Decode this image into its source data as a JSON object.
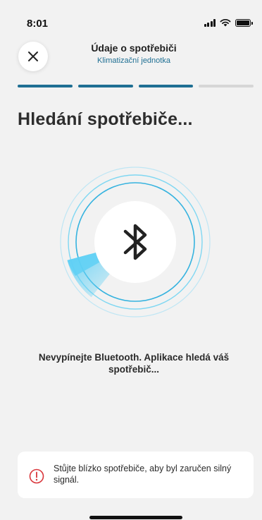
{
  "status_bar": {
    "time": "8:01"
  },
  "header": {
    "title": "Údaje o spotřebiči",
    "subtitle": "Klimatizační jednotka"
  },
  "progress": {
    "total_steps": 4,
    "completed_steps": 3,
    "active_color": "#1f6f93",
    "inactive_color": "#d6d6d6"
  },
  "page_title": "Hledání spotřebiče...",
  "scanner": {
    "icon": "bluetooth-icon",
    "ring_color": "#4cc7ec",
    "sweep_color": "#5fd0f5"
  },
  "status_message": "Nevypínejte Bluetooth. Aplikace hledá váš spotřebič...",
  "hint": {
    "icon": "warning-circle-icon",
    "icon_color": "#d9353a",
    "text": "Stůjte blízko spotřebiče, aby byl zaručen silný signál."
  }
}
